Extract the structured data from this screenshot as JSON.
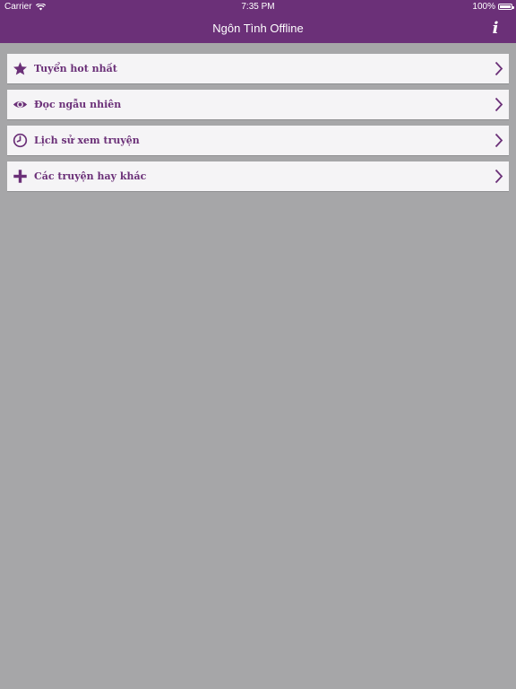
{
  "status": {
    "carrier": "Carrier",
    "time": "7:35 PM",
    "battery": "100%"
  },
  "navbar": {
    "title": "Ngôn Tình Offline",
    "info_icon": "info-icon"
  },
  "menu": {
    "items": [
      {
        "label": "Tuyển hot nhất",
        "icon": "star-icon"
      },
      {
        "label": "Đọc ngẫu nhiên",
        "icon": "eye-icon"
      },
      {
        "label": "Lịch sử xem truyện",
        "icon": "clock-icon"
      },
      {
        "label": "Các truyện hay khác",
        "icon": "plus-icon"
      }
    ]
  },
  "colors": {
    "accent": "#6b3078",
    "background": "#a6a6a8",
    "row": "#f5f4f6"
  }
}
